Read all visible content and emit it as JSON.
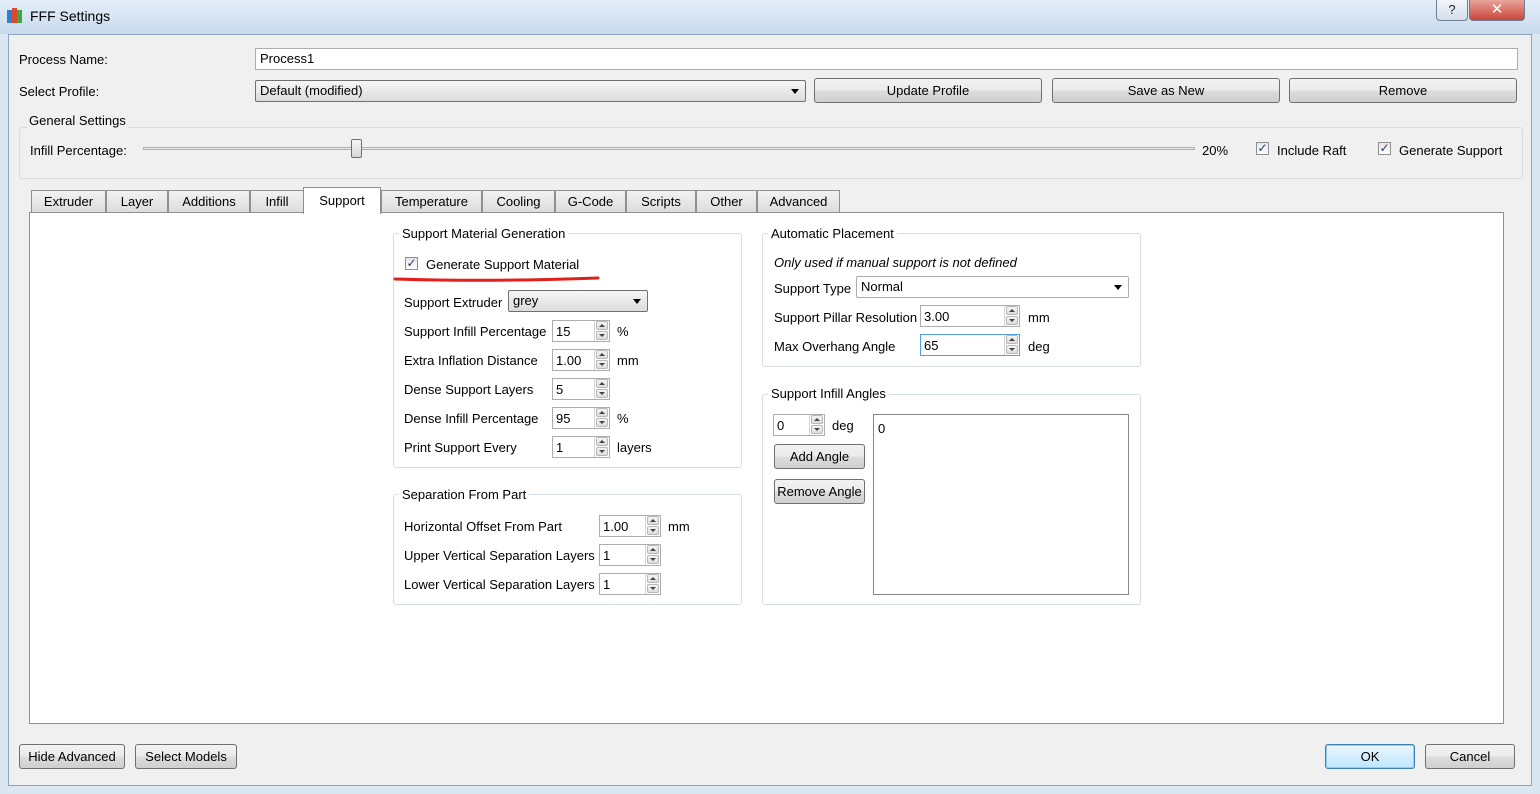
{
  "window": {
    "title": "FFF Settings",
    "help_glyph": "?",
    "close_glyph": "✕"
  },
  "process": {
    "name_label": "Process Name:",
    "name_value": "Process1",
    "profile_label": "Select Profile:",
    "profile_value": "Default (modified)",
    "update_profile": "Update Profile",
    "save_as_new": "Save as New",
    "remove": "Remove"
  },
  "general": {
    "title": "General Settings",
    "infill_label": "Infill Percentage:",
    "infill_value": "20%",
    "infill_fraction": 0.2,
    "include_raft_label": "Include Raft",
    "include_raft_checked": true,
    "generate_support_label": "Generate Support",
    "generate_support_checked": true
  },
  "tabs": [
    "Extruder",
    "Layer",
    "Additions",
    "Infill",
    "Support",
    "Temperature",
    "Cooling",
    "G-Code",
    "Scripts",
    "Other",
    "Advanced"
  ],
  "active_tab": "Support",
  "support_generation": {
    "title": "Support Material Generation",
    "generate_label": "Generate Support Material",
    "generate_checked": true,
    "extruder_label": "Support Extruder",
    "extruder_value": "grey",
    "infill_pct_label": "Support Infill Percentage",
    "infill_pct_value": "15",
    "infill_pct_unit": "%",
    "inflation_label": "Extra Inflation Distance",
    "inflation_value": "1.00",
    "inflation_unit": "mm",
    "dense_layers_label": "Dense Support Layers",
    "dense_layers_value": "5",
    "dense_infill_label": "Dense Infill Percentage",
    "dense_infill_value": "95",
    "dense_infill_unit": "%",
    "print_every_label": "Print Support Every",
    "print_every_value": "1",
    "print_every_unit": "layers"
  },
  "separation": {
    "title": "Separation From Part",
    "horizontal_label": "Horizontal Offset From Part",
    "horizontal_value": "1.00",
    "horizontal_unit": "mm",
    "upper_label": "Upper Vertical Separation Layers",
    "upper_value": "1",
    "lower_label": "Lower Vertical Separation Layers",
    "lower_value": "1"
  },
  "automatic": {
    "title": "Automatic Placement",
    "note": "Only used if manual support is not defined",
    "type_label": "Support Type",
    "type_value": "Normal",
    "pillar_label": "Support Pillar Resolution",
    "pillar_value": "3.00",
    "pillar_unit": "mm",
    "overhang_label": "Max Overhang Angle",
    "overhang_value": "65",
    "overhang_unit": "deg"
  },
  "infill_angles": {
    "title": "Support Infill Angles",
    "angle_value": "0",
    "angle_unit": "deg",
    "add_label": "Add Angle",
    "remove_label": "Remove Angle",
    "list_items": [
      "0"
    ]
  },
  "footer": {
    "hide_advanced": "Hide Advanced",
    "select_models": "Select Models",
    "ok": "OK",
    "cancel": "Cancel"
  },
  "colors": {
    "annotation_underline": "#e0201c"
  }
}
